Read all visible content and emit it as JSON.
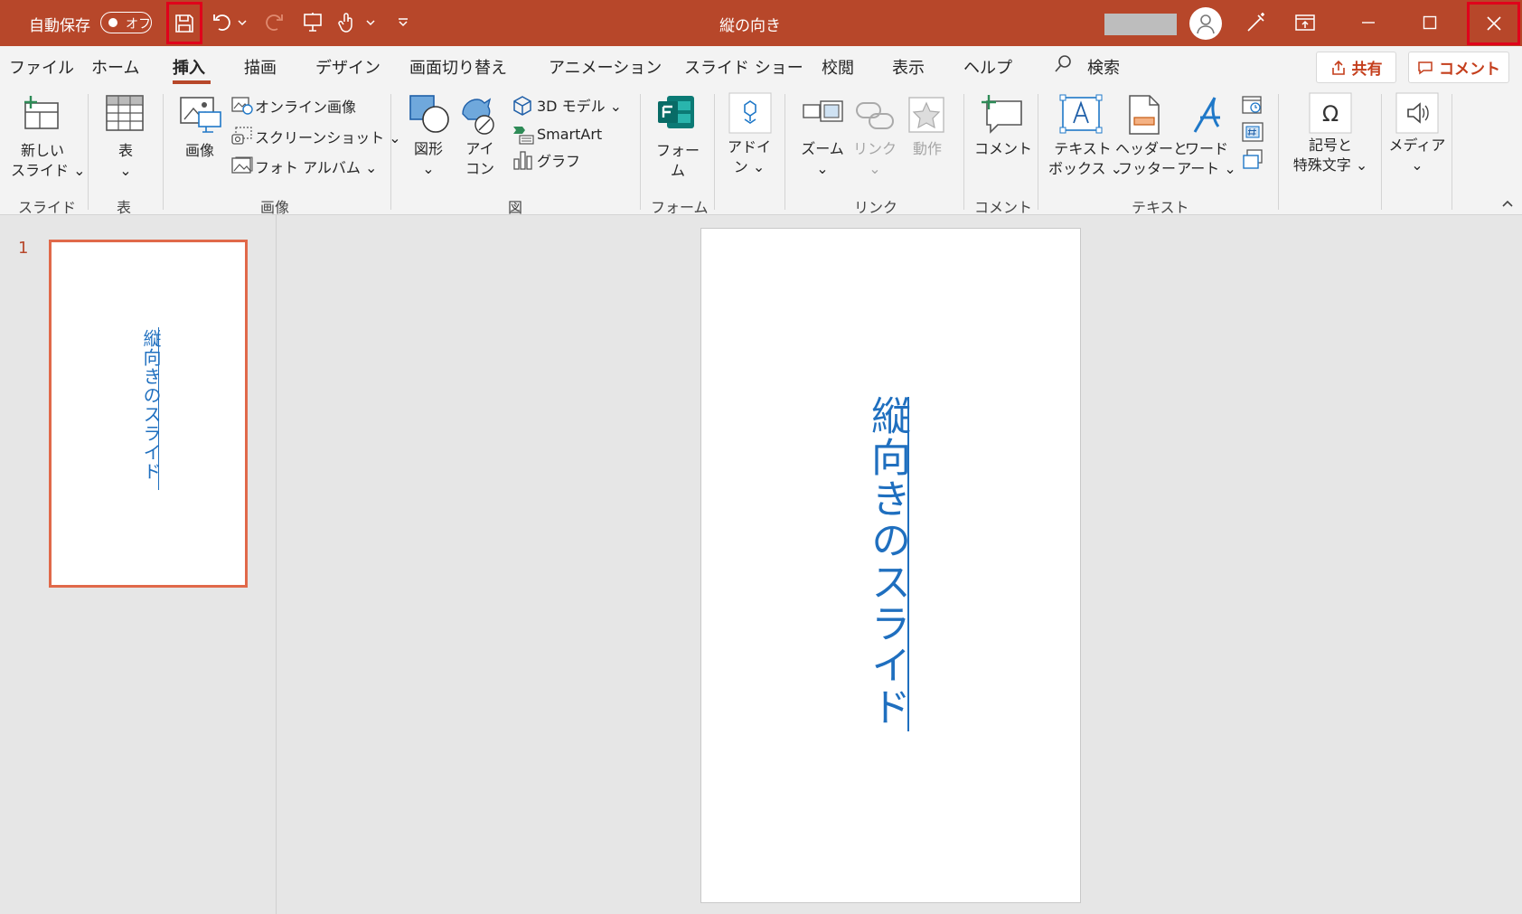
{
  "titlebar": {
    "autosave_label": "自動保存",
    "autosave_state": "オフ",
    "doc_title": "縦の向き"
  },
  "tabs": [
    "ファイル",
    "ホーム",
    "挿入",
    "描画",
    "デザイン",
    "画面切り替え",
    "アニメーション",
    "スライド ショー",
    "校閲",
    "表示",
    "ヘルプ"
  ],
  "active_tab": "挿入",
  "search_label": "検索",
  "share_label": "共有",
  "comment_label": "コメント",
  "ribbon": {
    "new_slide_1": "新しい",
    "new_slide_2": "スライド ⌄",
    "table": "表",
    "table_caret": "⌄",
    "image": "画像",
    "online_image": "オンライン画像",
    "screenshot": "スクリーンショット ⌄",
    "photo_album": "フォト アルバム ⌄",
    "shapes": "図形",
    "shapes_caret": "⌄",
    "icons_1": "アイ",
    "icons_2": "コン",
    "model3d": "3D モデル ⌄",
    "smartart": "SmartArt",
    "chart": "グラフ",
    "forms_1": "フォー",
    "forms_2": "ム",
    "addin_1": "アドイ",
    "addin_2": "ン ⌄",
    "zoom": "ズーム",
    "zoom_caret": "⌄",
    "link": "リンク",
    "link_caret": "⌄",
    "action": "動作",
    "comment": "コメント",
    "textbox_1": "テキスト",
    "textbox_2": "ボックス ⌄",
    "header_1": "ヘッダーと",
    "header_2": "フッター",
    "wordart_1": "ワード",
    "wordart_2": "アート ⌄",
    "symbol_1": "記号と",
    "symbol_2": "特殊文字 ⌄",
    "media": "メディア",
    "media_caret": "⌄"
  },
  "groups": {
    "slides": "スライド",
    "tables": "表",
    "images": "画像",
    "illustrations": "図",
    "forms": "フォーム",
    "links": "リンク",
    "comments": "コメント",
    "text": "テキスト"
  },
  "slide_panel": {
    "slide_number": "1"
  },
  "slide": {
    "text": "縦向きのスライド"
  },
  "colors": {
    "accent": "#b7472a",
    "highlight": "#e0001b",
    "slide_text": "#1f6fbf"
  }
}
